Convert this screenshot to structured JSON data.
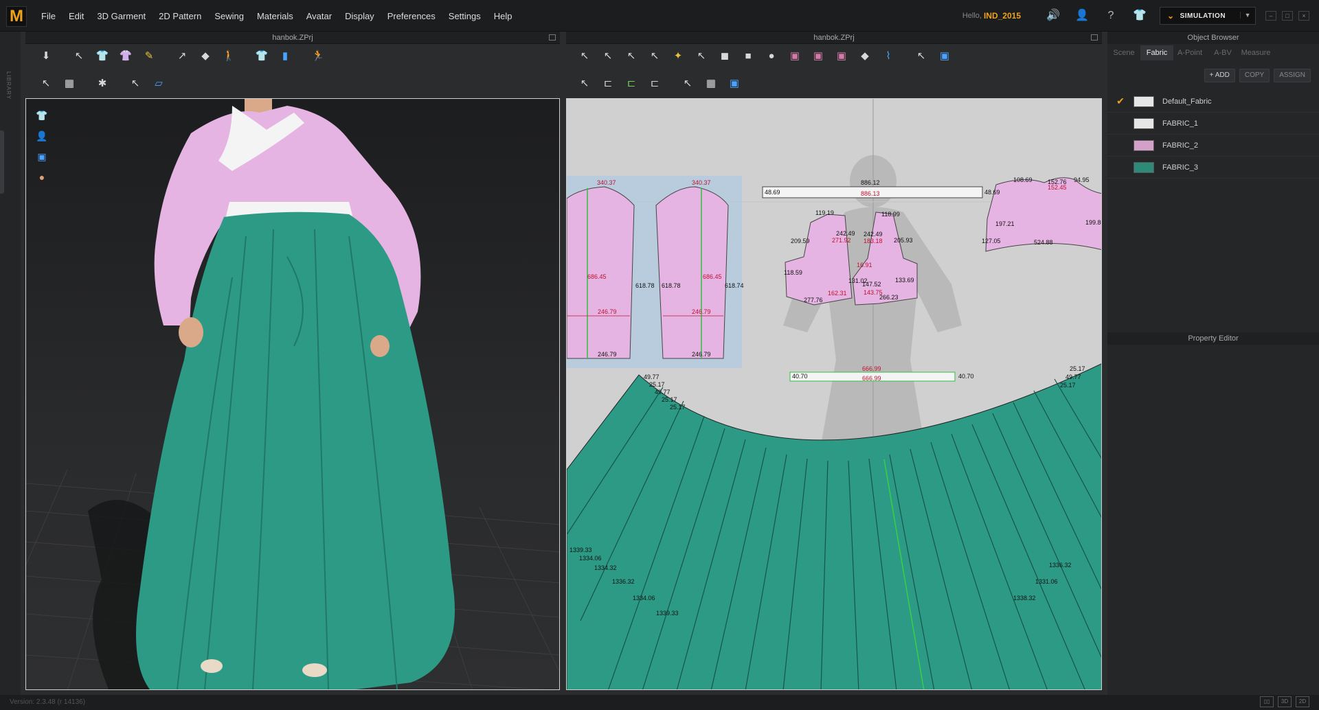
{
  "app": {
    "logo": "M"
  },
  "menu": [
    "File",
    "Edit",
    "3D Garment",
    "2D Pattern",
    "Sewing",
    "Materials",
    "Avatar",
    "Display",
    "Preferences",
    "Settings",
    "Help"
  ],
  "user": {
    "hello": "Hello,",
    "name": "IND_2015"
  },
  "simulation": {
    "label": "SIMULATION"
  },
  "sidebar": {
    "library_label": "LIBRARY"
  },
  "panels": {
    "left_title": "hanbok.ZPrj",
    "right_title": "hanbok.ZPrj"
  },
  "object_browser": {
    "title": "Object Browser",
    "tabs": [
      "Scene",
      "Fabric",
      "A-Point",
      "A-BV",
      "Measure"
    ],
    "active_tab": "Fabric",
    "actions": {
      "add": "+ ADD",
      "copy": "COPY",
      "assign": "ASSIGN"
    },
    "fabrics": [
      {
        "name": "Default_Fabric",
        "color": "#e6e6e6",
        "checked": true
      },
      {
        "name": "FABRIC_1",
        "color": "#e6e6e6",
        "checked": false
      },
      {
        "name": "FABRIC_2",
        "color": "#d2a0c8",
        "checked": false
      },
      {
        "name": "FABRIC_3",
        "color": "#2e8a78",
        "checked": false
      }
    ]
  },
  "property_editor": {
    "title": "Property Editor"
  },
  "status": {
    "version": "Version: 2.3.48     (r 14136)"
  },
  "colors": {
    "pink": "#e6b4e2",
    "teal": "#2c9a85",
    "accent": "#f0a21a"
  },
  "pattern_labels": {
    "sleeve": [
      "340.37",
      "686.45",
      "618.78",
      "246.79",
      "246.79"
    ],
    "sleeve2": [
      "340.37",
      "686.45",
      "618.78",
      "618.74",
      "246.79",
      "246.79"
    ],
    "collar": [
      "886.12",
      "886.13",
      "48.69",
      "48.69"
    ],
    "bodice_left": [
      "119.19",
      "242.49",
      "271.92",
      "209.59",
      "118.59",
      "131.02",
      "162.31",
      "277.76"
    ],
    "bodice_right": [
      "118.99",
      "242.49",
      "183.18",
      "205.93",
      "16.91",
      "147.52",
      "143.75",
      "133.69",
      "266.23"
    ],
    "back": [
      "108.69",
      "152.76",
      "94.95",
      "152.45",
      "197.21",
      "199.80",
      "127.05",
      "524.88"
    ],
    "band": [
      "666.99",
      "666.99",
      "40.70",
      "40.70"
    ],
    "skirt_top": [
      "49.77",
      "25.17",
      "49.77",
      "25.17",
      "25.17"
    ],
    "skirt_right": [
      "25.17",
      "49.77",
      "25.17"
    ],
    "skirt_bottom": [
      "1339.33",
      "1334.06",
      "1334.32",
      "1336.32",
      "1334.06",
      "1339.33"
    ],
    "skirt_right_bottom": [
      "1336.32",
      "1331.06",
      "1338.32"
    ]
  }
}
